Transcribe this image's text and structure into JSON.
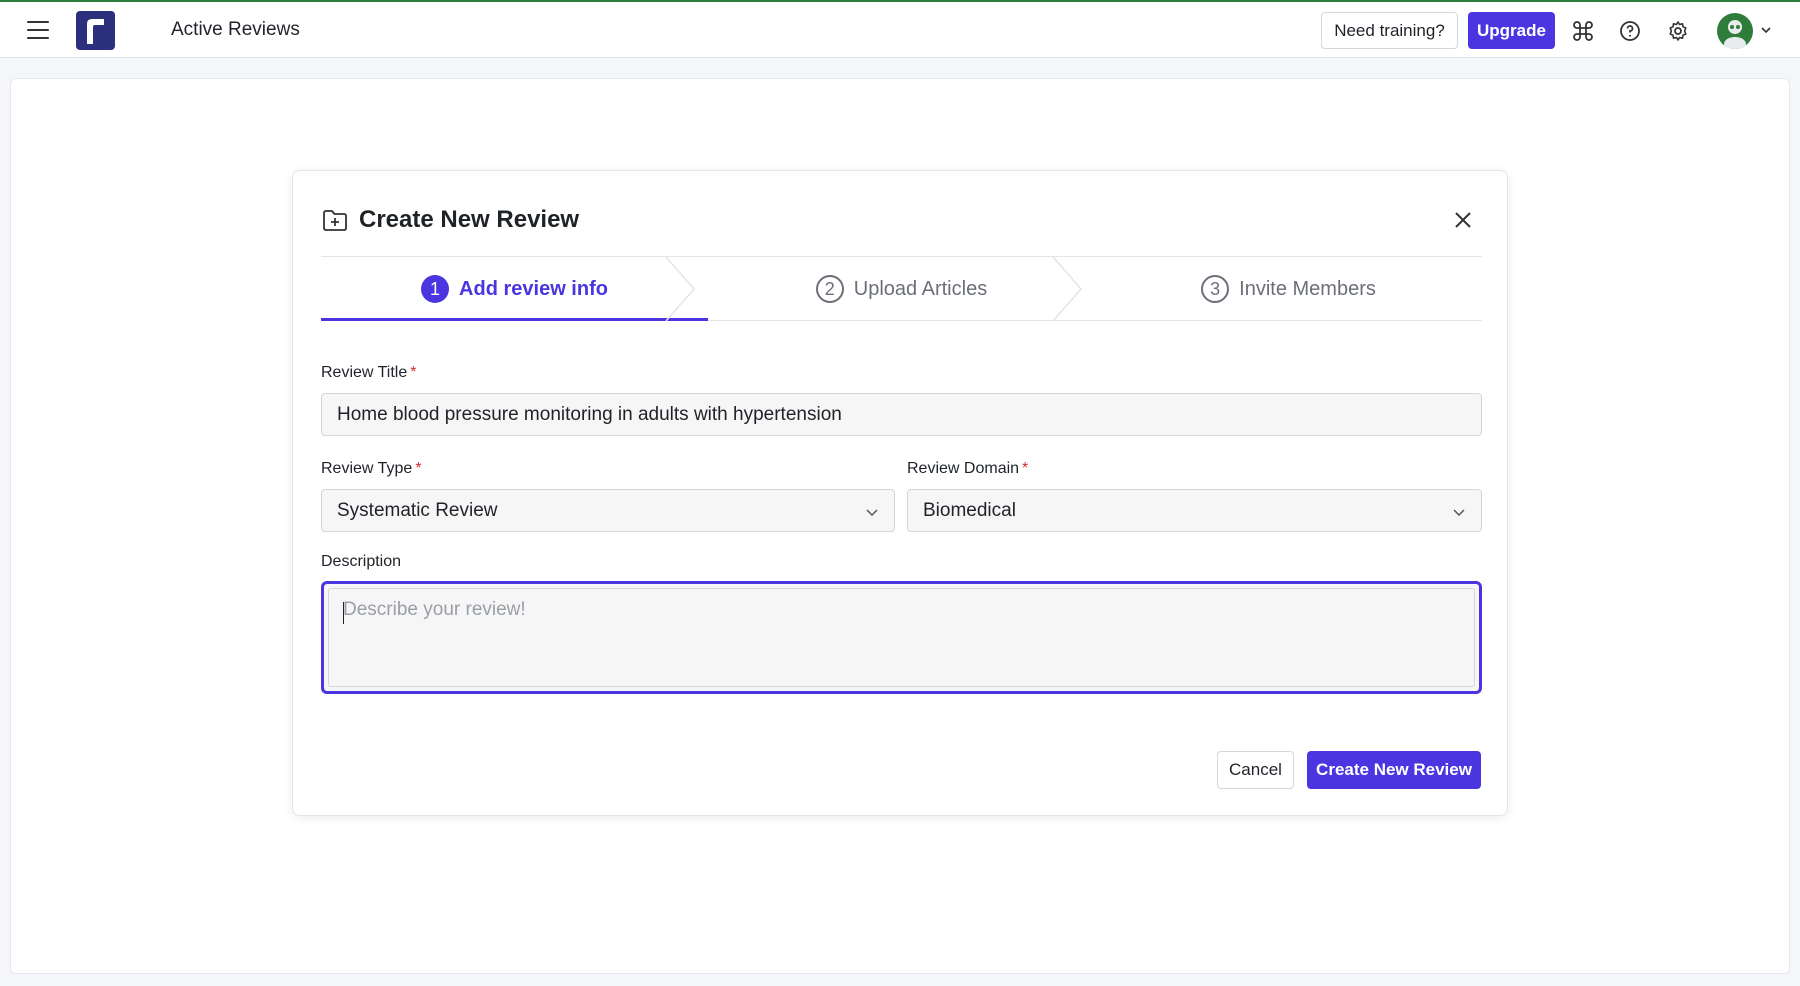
{
  "header": {
    "app_title": "Active Reviews",
    "training_label": "Need training?",
    "upgrade_label": "Upgrade",
    "icons": [
      "menu-icon",
      "logo",
      "command-icon",
      "help-icon",
      "settings-icon",
      "avatar",
      "chevron-down-icon"
    ],
    "accent_color": "#4a35e0"
  },
  "modal": {
    "title": "Create New Review",
    "steps": [
      {
        "number": "1",
        "label": "Add review info",
        "active": true
      },
      {
        "number": "2",
        "label": "Upload Articles",
        "active": false
      },
      {
        "number": "3",
        "label": "Invite Members",
        "active": false
      }
    ],
    "fields": {
      "title": {
        "label": "Review Title",
        "required_mark": "*",
        "value": "Home blood pressure monitoring in adults with hypertension"
      },
      "type": {
        "label": "Review Type",
        "required_mark": "*",
        "value": "Systematic Review"
      },
      "domain": {
        "label": "Review Domain",
        "required_mark": "*",
        "value": "Biomedical"
      },
      "description": {
        "label": "Description",
        "placeholder": "Describe your review!",
        "value": ""
      }
    },
    "cancel_label": "Cancel",
    "create_label": "Create New Review"
  }
}
